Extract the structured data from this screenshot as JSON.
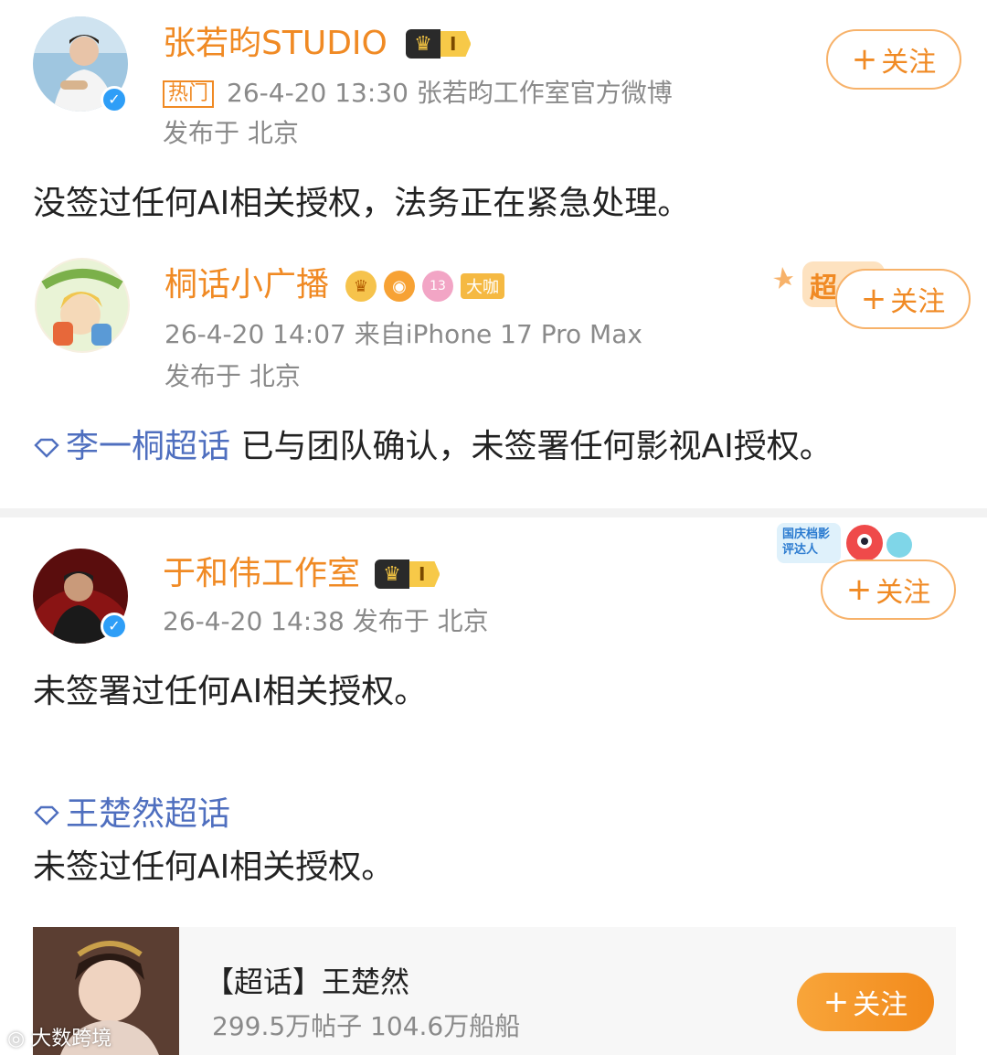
{
  "post1": {
    "name": "张若昀STUDIO",
    "level": "I",
    "hot_tag": "热门",
    "meta": "26-4-20 13:30  张若昀工作室官方微博",
    "location": "发布于 北京",
    "follow_label": "关注",
    "text": "没签过任何AI相关授权，法务正在紧急处理。"
  },
  "post2": {
    "name": "桐话小广播",
    "tag": "大咖",
    "fan_level": "13",
    "sticker": "超",
    "meta": "26-4-20 14:07  来自iPhone 17 Pro Max",
    "location": "发布于 北京",
    "follow_label": "关注",
    "topic": "李一桐超话",
    "text": " 已与团队确认，未签署任何影视AI授权。"
  },
  "post3": {
    "name": "于和伟工作室",
    "level": "I",
    "sticker": "国庆档影评达人",
    "meta": "26-4-20 14:38  发布于 北京",
    "follow_label": "关注",
    "text1": "未签署过任何AI相关授权。",
    "topic": "王楚然超话",
    "text2": "未签过任何AI相关授权。"
  },
  "card": {
    "title": "【超话】王楚然",
    "stats": "299.5万帖子 104.6万船船",
    "follow_label": "关注"
  },
  "watermark": "大数跨境",
  "colors": {
    "name_orange": "#f08a24",
    "link_blue": "#4f6fbf",
    "meta_gray": "#8a8a8a",
    "verified_blue": "#2e9ef7"
  }
}
